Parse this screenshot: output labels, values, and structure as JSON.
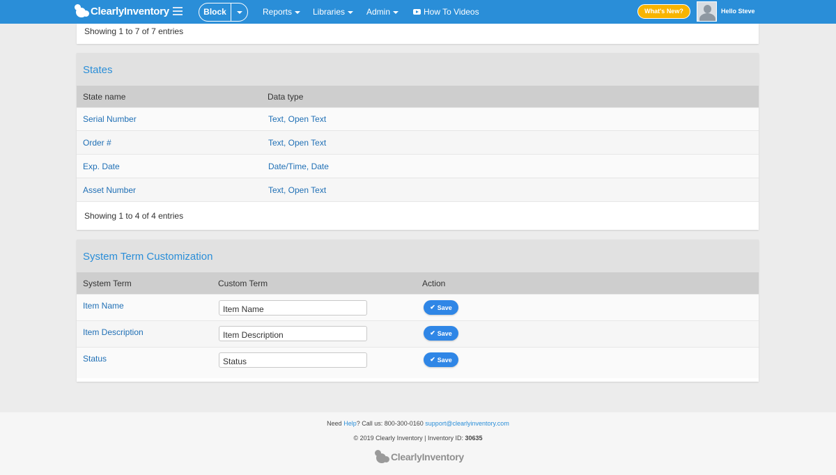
{
  "nav": {
    "brand": "ClearlyInventory",
    "block_label": "Block",
    "items": [
      "Reports",
      "Libraries",
      "Admin"
    ],
    "videos_label": "How To Videos",
    "whats_new": "What's New?",
    "greeting": "Hello Steve"
  },
  "top_panel": {
    "info": "Showing 1 to 7 of 7 entries"
  },
  "states": {
    "title": "States",
    "columns": [
      "State name",
      "Data type"
    ],
    "rows": [
      {
        "name": "Serial Number",
        "type": "Text, Open Text"
      },
      {
        "name": "Order #",
        "type": "Text, Open Text"
      },
      {
        "name": "Exp. Date",
        "type": "Date/Time, Date"
      },
      {
        "name": "Asset Number",
        "type": "Text, Open Text"
      }
    ],
    "info": "Showing 1 to 4 of 4 entries"
  },
  "terms": {
    "title": "System Term Customization",
    "columns": [
      "System Term",
      "Custom Term",
      "Action"
    ],
    "rows": [
      {
        "system": "Item Name",
        "custom": "Item Name"
      },
      {
        "system": "Item Description",
        "custom": "Item Description"
      },
      {
        "system": "Status",
        "custom": "Status"
      }
    ],
    "save_label": "Save"
  },
  "footer": {
    "need": "Need ",
    "help": "Help",
    "call": "? Call us: 800-300-0160 ",
    "email": "support@clearlyinventory.com",
    "copyright": "© 2019 Clearly Inventory | Inventory ID: ",
    "inventory_id": "30635",
    "brand": "ClearlyInventory"
  },
  "colors": {
    "nav_bg": "#2a8ed8",
    "link": "#1f6fb5",
    "save_button": "#2f86e6",
    "whats_new": "#f8b400"
  }
}
